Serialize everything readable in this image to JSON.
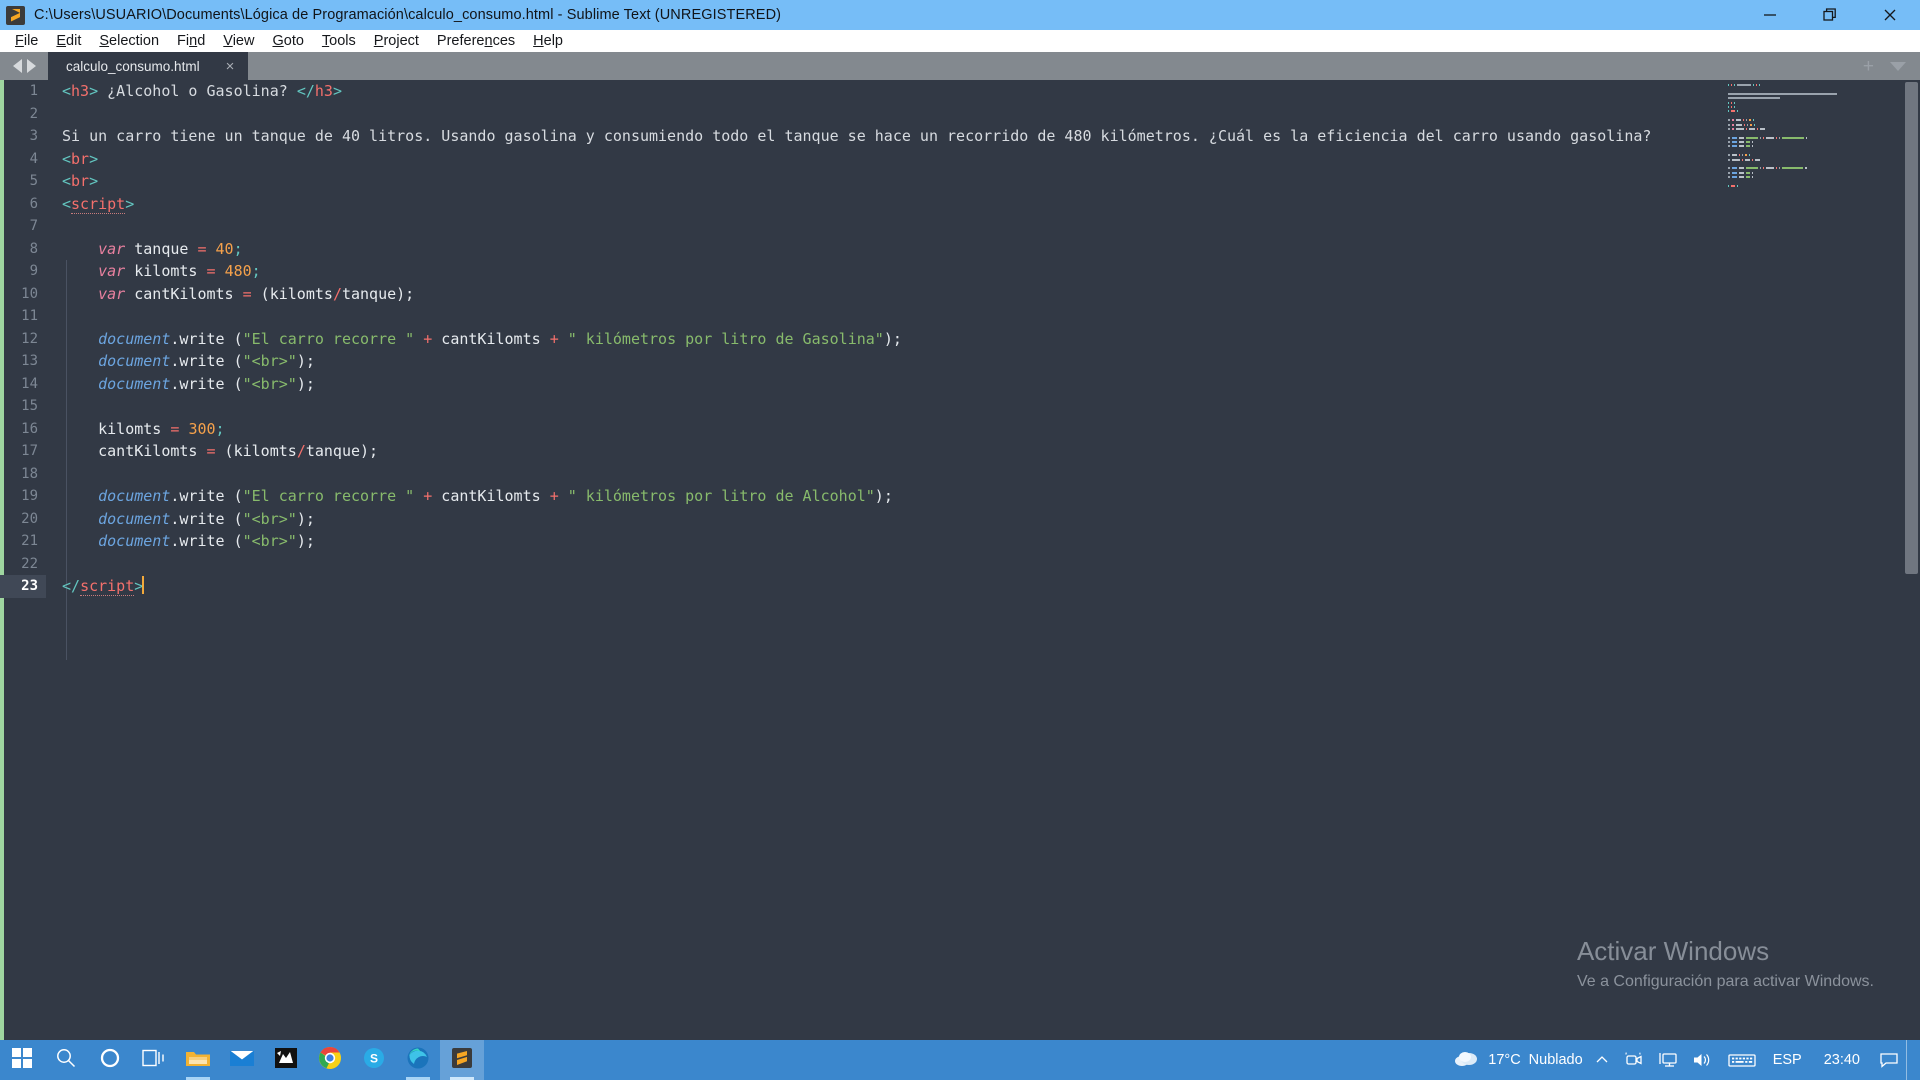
{
  "window": {
    "title": "C:\\Users\\USUARIO\\Documents\\Lógica de Programación\\calculo_consumo.html - Sublime Text (UNREGISTERED)",
    "app_icon": "sublime-text-icon",
    "controls": {
      "minimize": "minimize-icon",
      "restore": "restore-icon",
      "close": "close-icon"
    }
  },
  "menubar": {
    "items": [
      {
        "label": "File",
        "accel": "F"
      },
      {
        "label": "Edit",
        "accel": "E"
      },
      {
        "label": "Selection",
        "accel": "S"
      },
      {
        "label": "Find",
        "accel": "n"
      },
      {
        "label": "View",
        "accel": "V"
      },
      {
        "label": "Goto",
        "accel": "G"
      },
      {
        "label": "Tools",
        "accel": "T"
      },
      {
        "label": "Project",
        "accel": "P"
      },
      {
        "label": "Preferences",
        "accel": "n"
      },
      {
        "label": "Help",
        "accel": "H"
      }
    ]
  },
  "tabbar": {
    "prev_icon": "arrow-left-icon",
    "next_icon": "arrow-right-icon",
    "tabs": [
      {
        "label": "calculo_consumo.html",
        "close": "×",
        "active": true
      }
    ],
    "new_tab": "+",
    "tab_menu": "chevron-down-icon"
  },
  "editor": {
    "theme": "monokai-dark",
    "colors": {
      "background": "#323945",
      "gutter_text": "#7d8794",
      "active_line_gutter": "#404856",
      "punctuation": "#63c6c0",
      "tag": "#f4706c",
      "keyword": "#e8809f",
      "number": "#f5a14b",
      "string": "#88bb6c",
      "object": "#6ca5e0",
      "operator": "#f4706c",
      "caret": "#f2a93b"
    },
    "cursor": {
      "line": 23,
      "column": 10
    },
    "lines": [
      {
        "number": 1,
        "tokens": [
          {
            "t": "punct",
            "v": "<"
          },
          {
            "t": "tag",
            "v": "h3"
          },
          {
            "t": "punct",
            "v": ">"
          },
          {
            "t": "text",
            "v": " ¿Alcohol o Gasolina? "
          },
          {
            "t": "punct",
            "v": "</"
          },
          {
            "t": "tag",
            "v": "h3"
          },
          {
            "t": "punct",
            "v": ">"
          }
        ]
      },
      {
        "number": 2,
        "tokens": []
      },
      {
        "number": 3,
        "tokens": [
          {
            "t": "text",
            "v": "Si un carro tiene un tanque de 40 litros. Usando gasolina y consumiendo todo el tanque se hace un recorrido de 480 kilómetros. ¿Cuál es la eficiencia del carro usando gasolina?"
          }
        ]
      },
      {
        "number": 4,
        "tokens": [
          {
            "t": "punct",
            "v": "<"
          },
          {
            "t": "tag",
            "v": "br"
          },
          {
            "t": "punct",
            "v": ">"
          }
        ]
      },
      {
        "number": 5,
        "tokens": [
          {
            "t": "punct",
            "v": "<"
          },
          {
            "t": "tag",
            "v": "br"
          },
          {
            "t": "punct",
            "v": ">"
          }
        ]
      },
      {
        "number": 6,
        "tokens": [
          {
            "t": "punct",
            "v": "<"
          },
          {
            "t": "tag dotted",
            "v": "script"
          },
          {
            "t": "punct",
            "v": ">"
          }
        ]
      },
      {
        "number": 7,
        "tokens": []
      },
      {
        "number": 8,
        "tokens": [
          {
            "t": "text",
            "v": "    "
          },
          {
            "t": "kw",
            "v": "var"
          },
          {
            "t": "var",
            "v": " tanque "
          },
          {
            "t": "op",
            "v": "="
          },
          {
            "t": "text",
            "v": " "
          },
          {
            "t": "num",
            "v": "40"
          },
          {
            "t": "punct",
            "v": ";"
          }
        ]
      },
      {
        "number": 9,
        "tokens": [
          {
            "t": "text",
            "v": "    "
          },
          {
            "t": "kw",
            "v": "var"
          },
          {
            "t": "var",
            "v": " kilomts "
          },
          {
            "t": "op",
            "v": "="
          },
          {
            "t": "text",
            "v": " "
          },
          {
            "t": "num",
            "v": "480"
          },
          {
            "t": "punct",
            "v": ";"
          }
        ]
      },
      {
        "number": 10,
        "tokens": [
          {
            "t": "text",
            "v": "    "
          },
          {
            "t": "kw",
            "v": "var"
          },
          {
            "t": "var",
            "v": " cantKilomts "
          },
          {
            "t": "op",
            "v": "="
          },
          {
            "t": "var",
            "v": " (kilomts"
          },
          {
            "t": "op",
            "v": "/"
          },
          {
            "t": "var",
            "v": "tanque);"
          }
        ]
      },
      {
        "number": 11,
        "tokens": []
      },
      {
        "number": 12,
        "tokens": [
          {
            "t": "text",
            "v": "    "
          },
          {
            "t": "obj",
            "v": "document"
          },
          {
            "t": "prop",
            "v": ".write ("
          },
          {
            "t": "str",
            "v": "\"El carro recorre \""
          },
          {
            "t": "text",
            "v": " "
          },
          {
            "t": "op",
            "v": "+"
          },
          {
            "t": "var",
            "v": " cantKilomts "
          },
          {
            "t": "op",
            "v": "+"
          },
          {
            "t": "text",
            "v": " "
          },
          {
            "t": "str",
            "v": "\" kilómetros por litro de Gasolina\""
          },
          {
            "t": "prop",
            "v": ");"
          }
        ]
      },
      {
        "number": 13,
        "tokens": [
          {
            "t": "text",
            "v": "    "
          },
          {
            "t": "obj",
            "v": "document"
          },
          {
            "t": "prop",
            "v": ".write ("
          },
          {
            "t": "str",
            "v": "\"<br>\""
          },
          {
            "t": "prop",
            "v": ");"
          }
        ]
      },
      {
        "number": 14,
        "tokens": [
          {
            "t": "text",
            "v": "    "
          },
          {
            "t": "obj",
            "v": "document"
          },
          {
            "t": "prop",
            "v": ".write ("
          },
          {
            "t": "str",
            "v": "\"<br>\""
          },
          {
            "t": "prop",
            "v": ");"
          }
        ]
      },
      {
        "number": 15,
        "tokens": []
      },
      {
        "number": 16,
        "tokens": [
          {
            "t": "text",
            "v": "    "
          },
          {
            "t": "var",
            "v": "kilomts "
          },
          {
            "t": "op",
            "v": "="
          },
          {
            "t": "text",
            "v": " "
          },
          {
            "t": "num",
            "v": "300"
          },
          {
            "t": "punct",
            "v": ";"
          }
        ]
      },
      {
        "number": 17,
        "tokens": [
          {
            "t": "text",
            "v": "    "
          },
          {
            "t": "var",
            "v": "cantKilomts "
          },
          {
            "t": "op",
            "v": "="
          },
          {
            "t": "var",
            "v": " (kilomts"
          },
          {
            "t": "op",
            "v": "/"
          },
          {
            "t": "var",
            "v": "tanque);"
          }
        ]
      },
      {
        "number": 18,
        "tokens": []
      },
      {
        "number": 19,
        "tokens": [
          {
            "t": "text",
            "v": "    "
          },
          {
            "t": "obj",
            "v": "document"
          },
          {
            "t": "prop",
            "v": ".write ("
          },
          {
            "t": "str",
            "v": "\"El carro recorre \""
          },
          {
            "t": "text",
            "v": " "
          },
          {
            "t": "op",
            "v": "+"
          },
          {
            "t": "var",
            "v": " cantKilomts "
          },
          {
            "t": "op",
            "v": "+"
          },
          {
            "t": "text",
            "v": " "
          },
          {
            "t": "str",
            "v": "\" kilómetros por litro de Alcohol\""
          },
          {
            "t": "prop",
            "v": ");"
          }
        ]
      },
      {
        "number": 20,
        "tokens": [
          {
            "t": "text",
            "v": "    "
          },
          {
            "t": "obj",
            "v": "document"
          },
          {
            "t": "prop",
            "v": ".write ("
          },
          {
            "t": "str",
            "v": "\"<br>\""
          },
          {
            "t": "prop",
            "v": ");"
          }
        ]
      },
      {
        "number": 21,
        "tokens": [
          {
            "t": "text",
            "v": "    "
          },
          {
            "t": "obj",
            "v": "document"
          },
          {
            "t": "prop",
            "v": ".write ("
          },
          {
            "t": "str",
            "v": "\"<br>\""
          },
          {
            "t": "prop",
            "v": ");"
          }
        ]
      },
      {
        "number": 22,
        "tokens": []
      },
      {
        "number": 23,
        "active": true,
        "caret": true,
        "tokens": [
          {
            "t": "punct",
            "v": "</"
          },
          {
            "t": "tag dotted",
            "v": "script"
          },
          {
            "t": "punct",
            "v": ">"
          }
        ]
      }
    ]
  },
  "watermark": {
    "title": "Activar Windows",
    "subtitle": "Ve a Configuración para activar Windows."
  },
  "taskbar": {
    "background": "#3b87cd",
    "items": [
      {
        "name": "start-button",
        "icon": "windows-logo-icon",
        "running": false,
        "active": false
      },
      {
        "name": "search-button",
        "icon": "search-icon",
        "running": false,
        "active": false
      },
      {
        "name": "cortana-button",
        "icon": "cortana-icon",
        "running": false,
        "active": false
      },
      {
        "name": "task-view-button",
        "icon": "task-view-icon",
        "running": false,
        "active": false
      },
      {
        "name": "file-explorer",
        "icon": "folder-icon",
        "running": true,
        "active": false
      },
      {
        "name": "mail-app",
        "icon": "mail-icon",
        "running": false,
        "active": false
      },
      {
        "name": "unknown-app",
        "icon": "dog-silhouette-icon",
        "running": false,
        "active": false
      },
      {
        "name": "google-chrome",
        "icon": "chrome-icon",
        "running": false,
        "active": false
      },
      {
        "name": "skype",
        "icon": "skype-icon",
        "running": false,
        "active": false
      },
      {
        "name": "microsoft-edge",
        "icon": "edge-icon",
        "running": true,
        "active": false
      },
      {
        "name": "sublime-text",
        "icon": "sublime-text-icon",
        "running": true,
        "active": true
      }
    ],
    "tray": {
      "weather_icon": "cloud-icon",
      "temperature": "17°C",
      "condition": "Nublado",
      "overflow_icon": "chevron-up-icon",
      "camera_icon": "camera-icon",
      "network_icon": "network-icon",
      "volume_icon": "volume-icon",
      "keyboard_icon": "keyboard-icon",
      "language": "ESP",
      "clock": "23:40",
      "action_center_icon": "speech-bubble-icon"
    }
  }
}
